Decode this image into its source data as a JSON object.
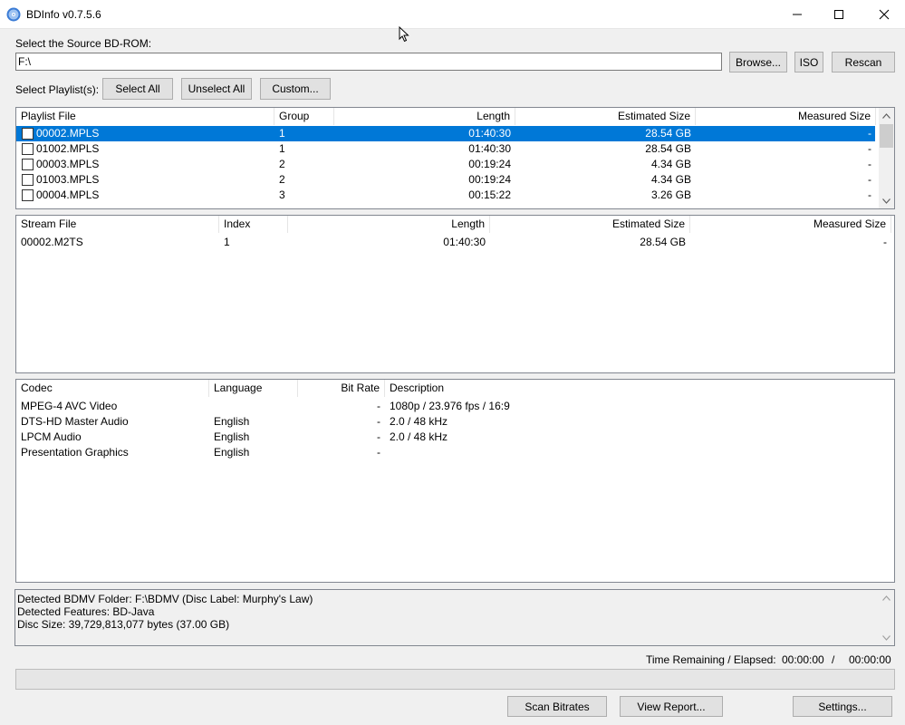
{
  "window": {
    "title": "BDInfo v0.7.5.6"
  },
  "source": {
    "label": "Select the Source BD-ROM:",
    "value": "F:\\",
    "browse_label": "Browse...",
    "iso_label": "ISO",
    "rescan_label": "Rescan"
  },
  "playlist_controls": {
    "label": "Select Playlist(s):",
    "select_all": "Select All",
    "unselect_all": "Unselect All",
    "custom": "Custom..."
  },
  "playlists": {
    "headers": [
      "Playlist File",
      "Group",
      "Length",
      "Estimated Size",
      "Measured Size"
    ],
    "rows": [
      {
        "file": "00002.MPLS",
        "group": "1",
        "length": "01:40:30",
        "est": "28.54 GB",
        "meas": "-"
      },
      {
        "file": "01002.MPLS",
        "group": "1",
        "length": "01:40:30",
        "est": "28.54 GB",
        "meas": "-"
      },
      {
        "file": "00003.MPLS",
        "group": "2",
        "length": "00:19:24",
        "est": "4.34 GB",
        "meas": "-"
      },
      {
        "file": "01003.MPLS",
        "group": "2",
        "length": "00:19:24",
        "est": "4.34 GB",
        "meas": "-"
      },
      {
        "file": "00004.MPLS",
        "group": "3",
        "length": "00:15:22",
        "est": "3.26 GB",
        "meas": "-"
      }
    ]
  },
  "streams": {
    "headers": [
      "Stream File",
      "Index",
      "Length",
      "Estimated Size",
      "Measured Size"
    ],
    "rows": [
      {
        "file": "00002.M2TS",
        "index": "1",
        "length": "01:40:30",
        "est": "28.54 GB",
        "meas": "-"
      }
    ]
  },
  "codecs": {
    "headers": [
      "Codec",
      "Language",
      "Bit Rate",
      "Description"
    ],
    "rows": [
      {
        "codec": "MPEG-4 AVC Video",
        "lang": "",
        "rate": "-",
        "desc": "1080p / 23.976 fps / 16:9"
      },
      {
        "codec": "DTS-HD Master Audio",
        "lang": "English",
        "rate": "-",
        "desc": "2.0 / 48 kHz"
      },
      {
        "codec": "LPCM Audio",
        "lang": "English",
        "rate": "-",
        "desc": "2.0 / 48 kHz"
      },
      {
        "codec": "Presentation Graphics",
        "lang": "English",
        "rate": "-",
        "desc": ""
      }
    ]
  },
  "info": {
    "lines": [
      "Detected BDMV Folder: F:\\BDMV (Disc Label: Murphy's Law)",
      "Detected Features: BD-Java",
      "Disc Size: 39,729,813,077 bytes (37.00 GB)"
    ]
  },
  "status": {
    "time_label": "Time Remaining / Elapsed:",
    "remaining": "00:00:00",
    "separator": "/",
    "elapsed": "00:00:00",
    "progress": 0
  },
  "actions": {
    "scan_bitrates": "Scan Bitrates",
    "view_report": "View Report...",
    "settings": "Settings..."
  },
  "colors": {
    "selection": "#0078d7",
    "window_bg": "#f0f0f0"
  }
}
